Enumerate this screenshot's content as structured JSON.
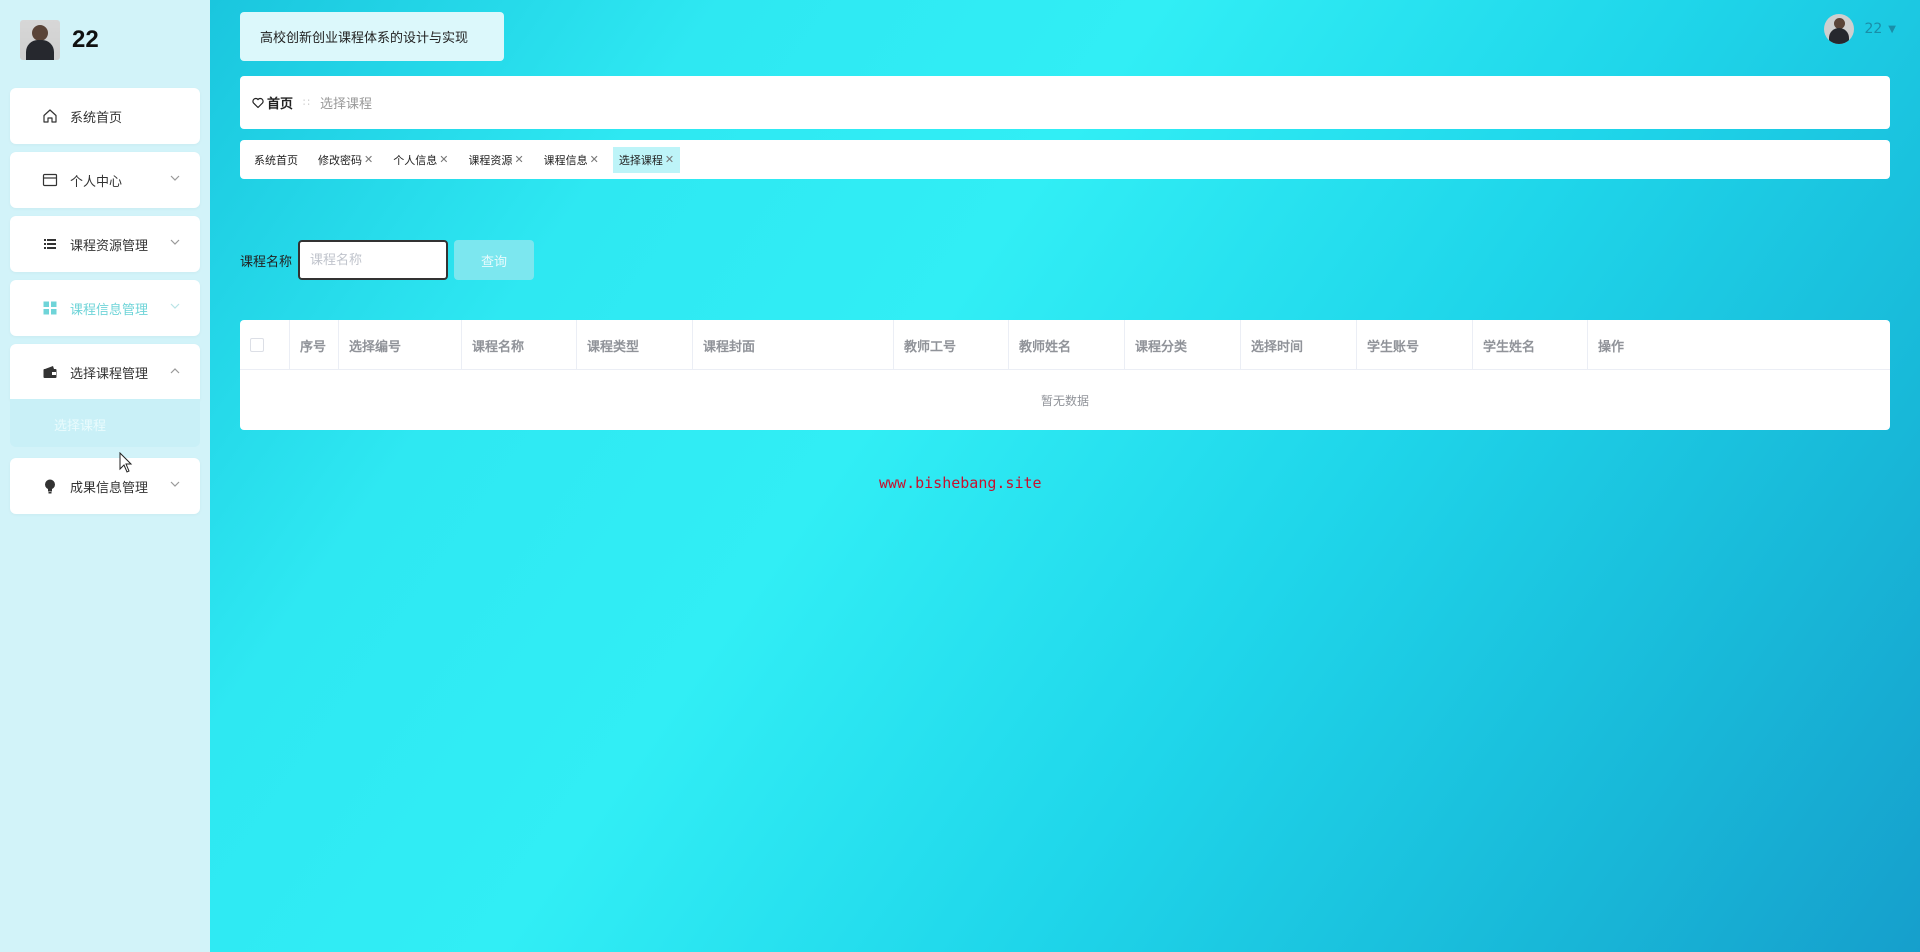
{
  "profile": {
    "username": "22"
  },
  "sidebar": {
    "items": [
      {
        "label": "系统首页",
        "icon": "home-icon"
      },
      {
        "label": "个人中心",
        "icon": "card-icon"
      },
      {
        "label": "课程资源管理",
        "icon": "list-icon"
      },
      {
        "label": "课程信息管理",
        "icon": "grid-icon"
      },
      {
        "label": "选择课程管理",
        "icon": "wallet-icon"
      },
      {
        "label": "成果信息管理",
        "icon": "bulb-icon"
      }
    ],
    "submenu_label": "选择课程"
  },
  "header": {
    "title": "高校创新创业课程体系的设计与实现",
    "user_label": "22"
  },
  "breadcrumb": {
    "home": "首页",
    "separator": "∷",
    "current": "选择课程"
  },
  "tags": [
    {
      "label": "系统首页",
      "closable": false
    },
    {
      "label": "修改密码",
      "closable": true
    },
    {
      "label": "个人信息",
      "closable": true
    },
    {
      "label": "课程资源",
      "closable": true
    },
    {
      "label": "课程信息",
      "closable": true
    },
    {
      "label": "选择课程",
      "closable": true,
      "active": true
    }
  ],
  "search": {
    "label": "课程名称",
    "placeholder": "课程名称",
    "button": "查询"
  },
  "table": {
    "columns": [
      "序号",
      "选择编号",
      "课程名称",
      "课程类型",
      "课程封面",
      "教师工号",
      "教师姓名",
      "课程分类",
      "选择时间",
      "学生账号",
      "学生姓名",
      "操作"
    ],
    "empty_text": "暂无数据"
  },
  "watermark": "www.bishebang.site",
  "colors": {
    "accent": "#31eef5",
    "sidebar_bg": "#d2f3f9",
    "tag_active": "#bdf4f8",
    "watermark": "#c8102e"
  }
}
